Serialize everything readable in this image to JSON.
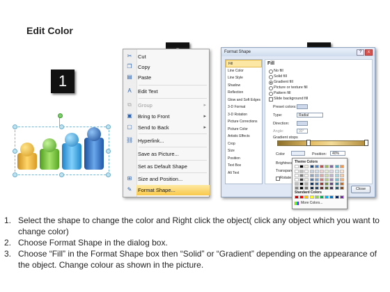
{
  "title": "Edit Color",
  "badges": [
    "1",
    "2",
    "3"
  ],
  "context_menu": {
    "items": [
      {
        "label": "Cut",
        "icon": "scissors-icon",
        "glyph": "✂",
        "disabled": false,
        "submenu": false,
        "highlighted": false
      },
      {
        "label": "Copy",
        "icon": "copy-icon",
        "glyph": "❐",
        "disabled": false,
        "submenu": false,
        "highlighted": false
      },
      {
        "label": "Paste",
        "icon": "paste-icon",
        "glyph": "📋",
        "disabled": false,
        "submenu": false,
        "highlighted": false
      },
      {
        "label": "Edit Text",
        "icon": "edit-text-icon",
        "glyph": "A",
        "disabled": false,
        "submenu": false,
        "highlighted": false
      },
      {
        "label": "Group",
        "icon": "group-icon",
        "glyph": "⧉",
        "disabled": true,
        "submenu": true,
        "highlighted": false
      },
      {
        "label": "Bring to Front",
        "icon": "bring-front-icon",
        "glyph": "▣",
        "disabled": false,
        "submenu": true,
        "highlighted": false
      },
      {
        "label": "Send to Back",
        "icon": "send-back-icon",
        "glyph": "▢",
        "disabled": false,
        "submenu": true,
        "highlighted": false
      },
      {
        "label": "Hyperlink...",
        "icon": "hyperlink-icon",
        "glyph": "🔗",
        "disabled": false,
        "submenu": false,
        "highlighted": false
      },
      {
        "label": "Save as Picture...",
        "icon": "",
        "glyph": "",
        "disabled": false,
        "submenu": false,
        "highlighted": false
      },
      {
        "label": "Set as Default Shape",
        "icon": "",
        "glyph": "",
        "disabled": false,
        "submenu": false,
        "highlighted": false
      },
      {
        "label": "Size and Position...",
        "icon": "size-position-icon",
        "glyph": "⊞",
        "disabled": false,
        "submenu": false,
        "highlighted": false
      },
      {
        "label": "Format Shape...",
        "icon": "format-shape-icon",
        "glyph": "✎",
        "disabled": false,
        "submenu": false,
        "highlighted": true
      }
    ]
  },
  "dialog": {
    "title": "Format Shape",
    "help": "?",
    "close_x": "x",
    "categories": [
      "Fill",
      "Line Color",
      "Line Style",
      "Shadow",
      "Reflection",
      "Glow and Soft Edges",
      "3-D Format",
      "3-D Rotation",
      "Picture Corrections",
      "Picture Color",
      "Artistic Effects",
      "Crop",
      "Size",
      "Position",
      "Text Box",
      "Alt Text"
    ],
    "selected_category": "Fill",
    "fill_heading": "Fill",
    "fill_options": [
      "No fill",
      "Solid fill",
      "Gradient fill",
      "Picture or texture fill",
      "Pattern fill",
      "Slide background fill"
    ],
    "fill_selected": "Gradient fill",
    "preset_label": "Preset colors:",
    "type_label": "Type:",
    "type_value": "Radial",
    "direction_label": "Direction:",
    "angle_label": "Angle:",
    "angle_value": "90°",
    "stops_label": "Gradient stops",
    "color_label": "Color",
    "position_label": "Position:",
    "position_value": "40%",
    "brightness_label": "Brightness",
    "transparency_label": "Transpare",
    "rotate_label": "Rotate",
    "close_button": "Close",
    "palette": {
      "theme_label": "Theme Colors",
      "standard_label": "Standard Colors",
      "more_label": "More Colors...",
      "theme_top": [
        "#ffffff",
        "#000000",
        "#eeece1",
        "#1f497d",
        "#4f81bd",
        "#c0504d",
        "#9bbb59",
        "#8064a2",
        "#4bacc6",
        "#f79646"
      ],
      "standard": [
        "#c00000",
        "#ff0000",
        "#ffc000",
        "#ffff00",
        "#92d050",
        "#00b050",
        "#00b0f0",
        "#0070c0",
        "#002060",
        "#7030a0"
      ]
    }
  },
  "instructions": [
    {
      "num": "1.",
      "text": "Select the shape to change the color and Right click the object( click any object which you want to change color)"
    },
    {
      "num": "2.",
      "text": "Choose Format Shape in the dialog box."
    },
    {
      "num": "3.",
      "text": "Choose “Fill” in the Format Shape box then “Solid” or “Gradient” depending on the appearance of the object. Change colour as shown in the picture."
    }
  ]
}
